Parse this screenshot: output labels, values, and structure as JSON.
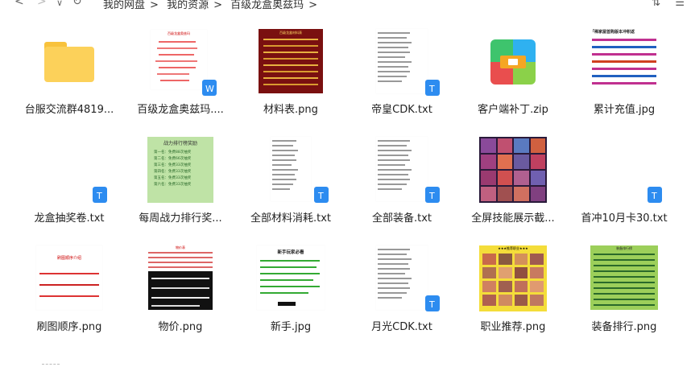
{
  "breadcrumb": [
    "我的网盘",
    "我的资源",
    "百级龙盒奥兹玛"
  ],
  "nav": {
    "back": "<",
    "forward": ">",
    "dropdown": "∨",
    "refresh": "↻"
  },
  "toolbar": {
    "sort_icon": "sort-icon",
    "list_icon": "list-view-icon"
  },
  "files": [
    {
      "name": "台服交流群4819...",
      "type": "folder"
    },
    {
      "name": "百级龙盒奥兹玛....",
      "type": "docx"
    },
    {
      "name": "材料表.png",
      "type": "image"
    },
    {
      "name": "帝皇CDK.txt",
      "type": "txt"
    },
    {
      "name": "客户端补丁.zip",
      "type": "zip"
    },
    {
      "name": "累计充值.jpg",
      "type": "image"
    },
    {
      "name": "龙盒抽奖卷.txt",
      "type": "txt"
    },
    {
      "name": "每周战力排行奖...",
      "type": "image"
    },
    {
      "name": "全部材料消耗.txt",
      "type": "txt"
    },
    {
      "name": "全部装备.txt",
      "type": "txt"
    },
    {
      "name": "全屏技能展示截...",
      "type": "image"
    },
    {
      "name": "首冲10月卡30.txt",
      "type": "txt"
    },
    {
      "name": "刷图顺序.png",
      "type": "image"
    },
    {
      "name": "物价.png",
      "type": "image"
    },
    {
      "name": "新手.jpg",
      "type": "image"
    },
    {
      "name": "月光CDK.txt",
      "type": "txt"
    },
    {
      "name": "职业推荐.png",
      "type": "image"
    },
    {
      "name": "装备排行.png",
      "type": "image"
    }
  ],
  "thumb_text": {
    "docx_title": "百级龙盒奥兹玛",
    "materials_title": "百级龙盒材料表",
    "recharge_title": "「稀家屋首购版本冲积返",
    "rank_title": "战力排行榜奖励",
    "rank_rows": [
      "第一名：免费88次抽奖",
      "第二名：免费66次抽奖",
      "第三名：免费33次抽奖",
      "第四名：免费33次抽奖",
      "第五名：免费33次抽奖",
      "第六名：免费33次抽奖"
    ],
    "route_title": "刷图顺序介绍",
    "price_title": "物价表",
    "newbie_title": "新手玩家必看",
    "job_title": "★★★推荐职业★★★",
    "equip_title": "装备排行榜"
  },
  "colors": {
    "folder": "#fcd15a",
    "txt_badge": "#2d8cf0",
    "zip_green": "#3ec46d",
    "zip_orange": "#f5a623"
  }
}
